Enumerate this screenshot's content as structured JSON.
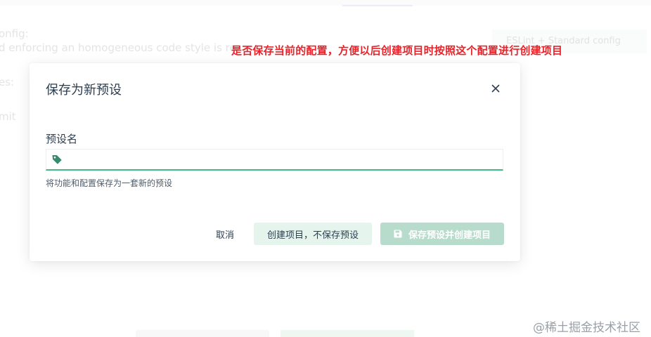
{
  "background": {
    "line1": "onfig:",
    "line2": "d enforcing an homogeneous code style is re",
    "line3": "es:",
    "line4": "mit",
    "chip": "ESLint + Standard config"
  },
  "annotation": "是否保存当前的配置，方便以后创建项目时按照这个配置进行创建项目",
  "dialog": {
    "title": "保存为新预设",
    "field_label": "预设名",
    "input_value": "",
    "input_placeholder": "",
    "help_text": "将功能和配置保存为一套新的预设",
    "cancel_label": "取消",
    "create_label": "创建项目，不保存预设",
    "save_label": "保存预设并创建项目"
  },
  "colors": {
    "accent": "#42b983",
    "annotation": "#e8232a"
  },
  "icons": {
    "close": "close-icon",
    "tag": "tag-icon",
    "save": "floppy-disk-icon"
  },
  "watermark": "@稀土掘金技术社区"
}
